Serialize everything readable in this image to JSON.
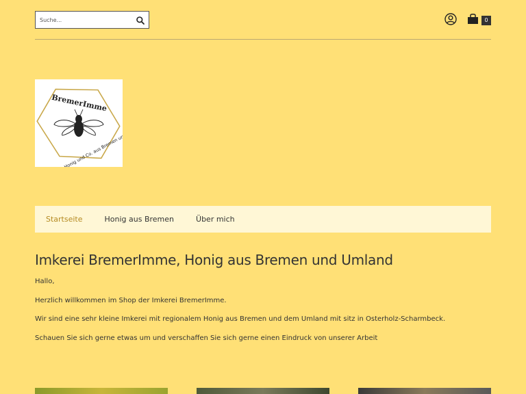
{
  "search": {
    "placeholder": "Suche..."
  },
  "cart": {
    "count": "0"
  },
  "logo": {
    "name": "BremerImme",
    "tagline": "Honig und Co. aus Bremen und Umzu"
  },
  "nav": {
    "items": [
      {
        "label": "Startseite",
        "active": true
      },
      {
        "label": "Honig aus Bremen",
        "active": false
      },
      {
        "label": "Über mich",
        "active": false
      }
    ]
  },
  "content": {
    "title": "Imkerei BremerImme, Honig aus Bremen und Umland",
    "paragraphs": [
      "Hallo,",
      "Herzlich willkommen im Shop der Imkerei BremerImme.",
      "Wir sind eine sehr kleine Imkerei mit regionalem Honig aus Bremen und dem Umland mit sitz in Osterholz-Scharmbeck.",
      "Schauen Sie sich gerne etwas um und verschaffen Sie sich gerne einen Eindruck von unserer Arbeit"
    ]
  },
  "colors": {
    "background": "#ffe076",
    "nav_bg": "#fff7d6",
    "accent": "#b58a22",
    "text": "#333333"
  }
}
